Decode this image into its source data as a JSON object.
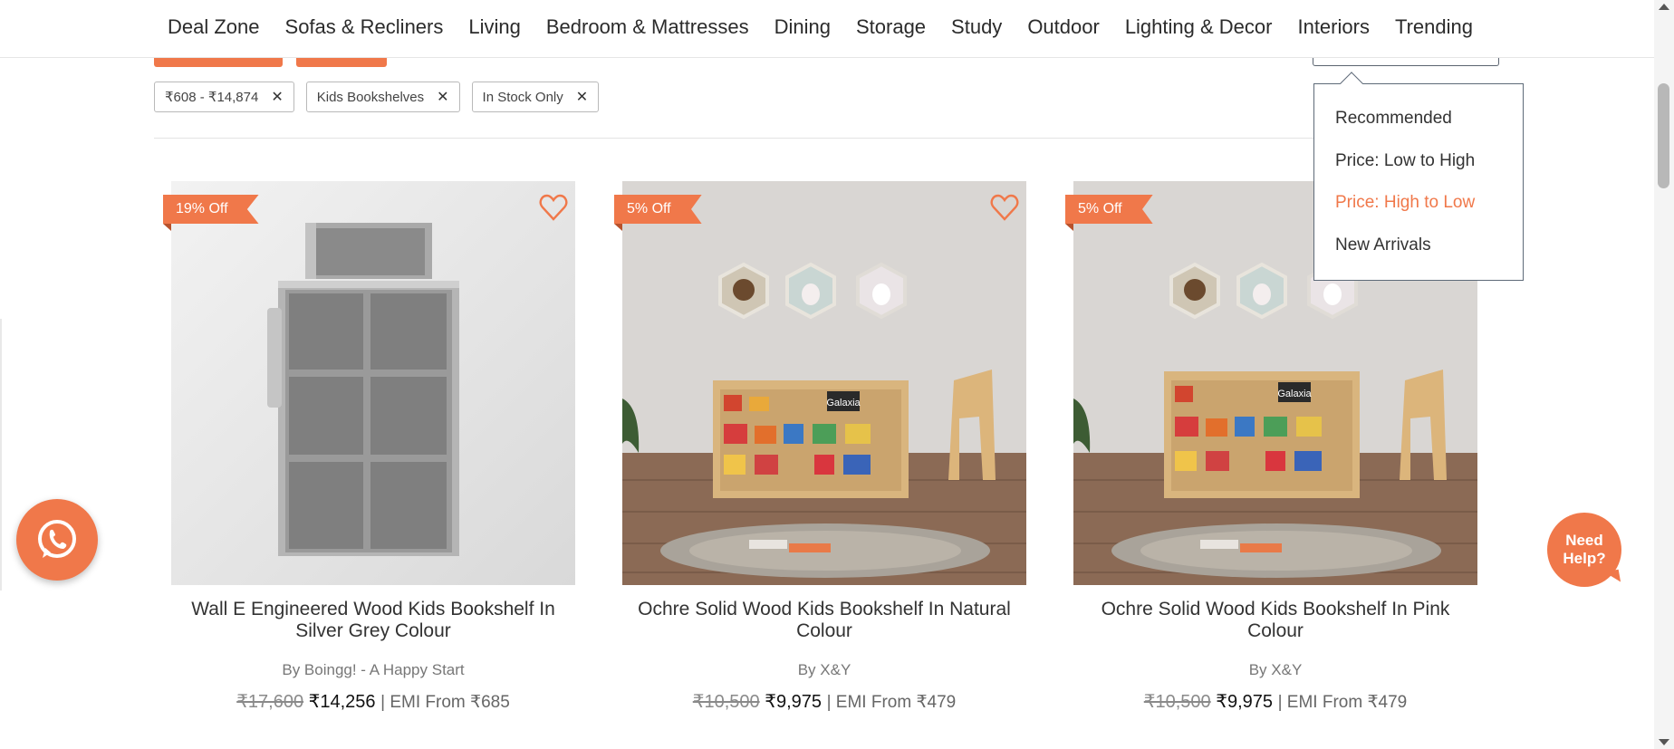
{
  "nav": {
    "items": [
      "Deal Zone",
      "Sofas & Recliners",
      "Living",
      "Bedroom & Mattresses",
      "Dining",
      "Storage",
      "Study",
      "Outdoor",
      "Lighting & Decor",
      "Interiors",
      "Trending"
    ]
  },
  "filters": {
    "chips": [
      {
        "label": "₹608 - ₹14,874"
      },
      {
        "label": "Kids Bookshelves"
      },
      {
        "label": "In Stock Only"
      }
    ],
    "remove_icon": "close-icon"
  },
  "sort": {
    "options": [
      "Recommended",
      "Price: Low to High",
      "Price: High to Low",
      "New Arrivals"
    ],
    "selected": "Price: High to Low"
  },
  "products": [
    {
      "badge": "19% Off",
      "title": "Wall E Engineered Wood Kids Bookshelf In Silver Grey Colour",
      "brand": "By Boingg! - A Happy Start",
      "mrp": "₹17,600",
      "price": "₹14,256",
      "emi": "| EMI From ₹685",
      "color": "silver-grey"
    },
    {
      "badge": "5% Off",
      "title": "Ochre Solid Wood Kids Bookshelf In Natural Colour",
      "brand": "By X&Y",
      "mrp": "₹10,500",
      "price": "₹9,975",
      "emi": "| EMI From ₹479",
      "color": "natural"
    },
    {
      "badge": "5% Off",
      "title": "Ochre Solid Wood Kids Bookshelf In Pink Colour",
      "brand": "By X&Y",
      "mrp": "₹10,500",
      "price": "₹9,975",
      "emi": "| EMI From ₹479",
      "color": "pink"
    }
  ],
  "image_text": {
    "book_title": "Galaxia"
  },
  "help": {
    "label_line1": "Need",
    "label_line2": "Help?"
  },
  "colors": {
    "accent": "#f0784a",
    "text": "#333333",
    "border": "#b9b9b9"
  }
}
